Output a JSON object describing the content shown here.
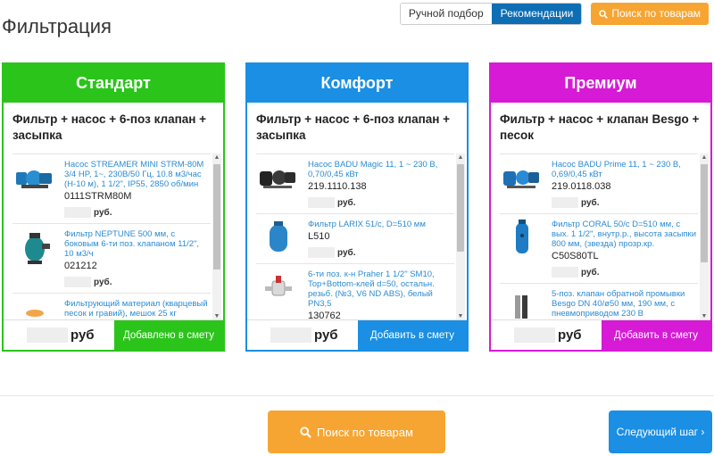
{
  "page_title": "Фильтрация",
  "toggle": {
    "manual": "Ручной подбор",
    "recommendations": "Рекомендации"
  },
  "search_top": "Поиск по товарам",
  "cards": [
    {
      "title": "Стандарт",
      "color": "#2bc41b",
      "subtitle": "Фильтр + насос + 6-поз клапан + засыпка",
      "items": [
        {
          "name": "Насос STREAMER MINI STRM-80M 3/4 HP, 1~, 230В/50 Гц, 10.8 м3/час (H-10 м), 1 1/2\", IP55, 2850 об/мин",
          "code": "0111STRM80M",
          "unit": "руб."
        },
        {
          "name": "Фильтр NEPTUNE 500 мм, с боковым 6-ти поз. клапаном 11/2\", 10 м3/ч",
          "code": "021212",
          "unit": "руб."
        },
        {
          "name": "Фильтрующий материал (кварцевый песок и гравий), мешок 25 кг",
          "code": "",
          "unit": ""
        }
      ],
      "foot_unit": "руб",
      "foot_button": "Добавлено в смету"
    },
    {
      "title": "Комфорт",
      "color": "#1a8fe3",
      "subtitle": "Фильтр + насос + 6-поз клапан + засыпка",
      "items": [
        {
          "name": "Насос BADU Magic 11, 1 ~ 230 В, 0,70/0,45 кВт",
          "code": "219.1110.138",
          "unit": "руб."
        },
        {
          "name": "Фильтр LARIX 51/с, D=510 мм",
          "code": "L510",
          "unit": "руб."
        },
        {
          "name": "6-ти поз. к-н Praher 1 1/2\" SM10, Top+Bottom-клей d=50, остальн. резьб. (№3, V6 ND ABS), белый PN3,5",
          "code": "130762",
          "unit": ""
        }
      ],
      "foot_unit": "руб",
      "foot_button": "Добавить в смету"
    },
    {
      "title": "Премиум",
      "color": "#d61ad6",
      "subtitle": "Фильтр + насос + клапан Besgo + песок",
      "items": [
        {
          "name": "Насос BADU Prime 11, 1 ~ 230 В, 0,69/0,45 кВт",
          "code": "219.0118.038",
          "unit": "руб."
        },
        {
          "name": "Фильтр CORAL 50/с D=510 мм, с вых. 1 1/2\", внутр.р., высота засыпки 800 мм, (звезда) прозр.кр.",
          "code": "C50S80TL",
          "unit": "руб."
        },
        {
          "name": "5-поз. клапан обратной промывки Besgo DN 40/ø50 мм, 190 мм, с пневмоприводом 230 В",
          "code": "",
          "unit": ""
        }
      ],
      "foot_unit": "руб",
      "foot_button": "Добавить в смету"
    }
  ],
  "search_bottom": "Поиск по товарам",
  "next_step": "Следующий шаг ›"
}
